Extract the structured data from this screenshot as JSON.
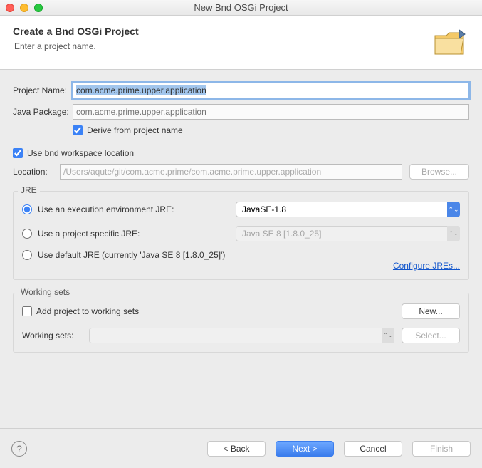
{
  "window": {
    "title": "New Bnd OSGi Project"
  },
  "header": {
    "title": "Create a Bnd OSGi Project",
    "subtitle": "Enter a project name."
  },
  "form": {
    "project_name_label": "Project Name:",
    "project_name_value": "com.acme.prime.upper.application",
    "java_package_label": "Java Package:",
    "java_package_placeholder": "com.acme.prime.upper.application",
    "derive_label": "Derive from project name",
    "workspace_label": "Use bnd workspace location",
    "location_label": "Location:",
    "location_value": "/Users/aqute/git/com.acme.prime/com.acme.prime.upper.application",
    "browse_label": "Browse..."
  },
  "jre": {
    "group_title": "JRE",
    "exec_env_label": "Use an execution environment JRE:",
    "exec_env_value": "JavaSE-1.8",
    "project_specific_label": "Use a project specific JRE:",
    "project_specific_value": "Java SE 8 [1.8.0_25]",
    "default_label": "Use default JRE (currently 'Java SE 8 [1.8.0_25]')",
    "configure_label": "Configure JREs..."
  },
  "working_sets": {
    "group_title": "Working sets",
    "add_label": "Add project to working sets",
    "new_label": "New...",
    "ws_label": "Working sets:",
    "select_label": "Select..."
  },
  "footer": {
    "back": "< Back",
    "next": "Next >",
    "cancel": "Cancel",
    "finish": "Finish"
  }
}
